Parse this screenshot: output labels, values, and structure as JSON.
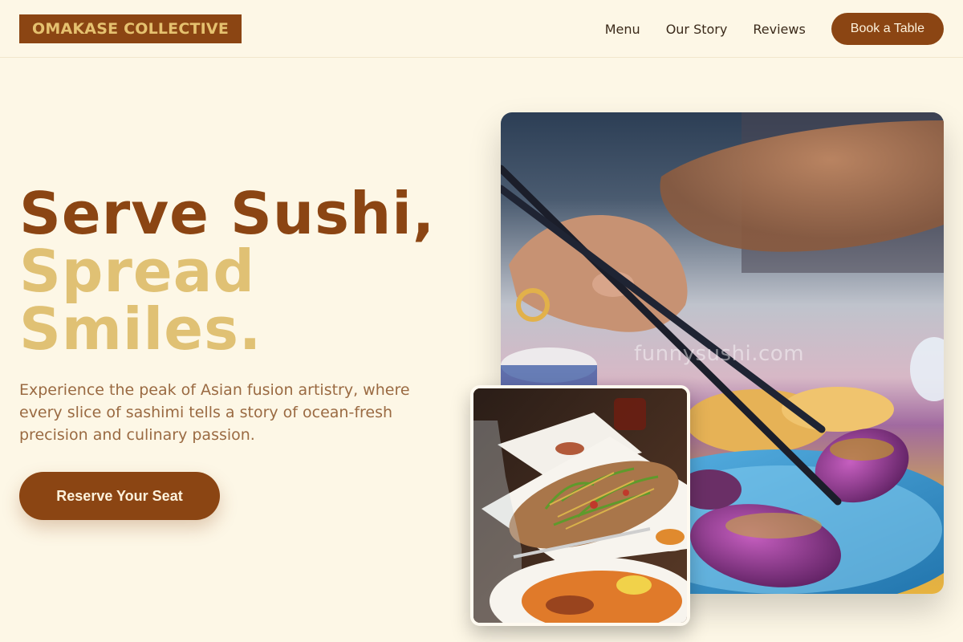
{
  "header": {
    "logo": "OMAKASE COLLECTIVE",
    "nav": [
      {
        "label": "Menu"
      },
      {
        "label": "Our Story"
      },
      {
        "label": "Reviews"
      }
    ],
    "cta": "Book a Table"
  },
  "hero": {
    "title_line1": "Serve Sushi,",
    "title_line2": "Spread",
    "title_line3": "Smiles.",
    "subtitle": "Experience the peak of Asian fusion artistry, where every slice of sashimi tells a story of ocean-fresh precision and culinary passion.",
    "button": "Reserve Your Seat"
  },
  "images": {
    "main_watermark": "funnysushi.com"
  },
  "colors": {
    "background": "#fdf7e6",
    "brand_brown": "#8b4513",
    "accent_gold": "#e0c174",
    "subtitle_text": "#9a6a42"
  }
}
